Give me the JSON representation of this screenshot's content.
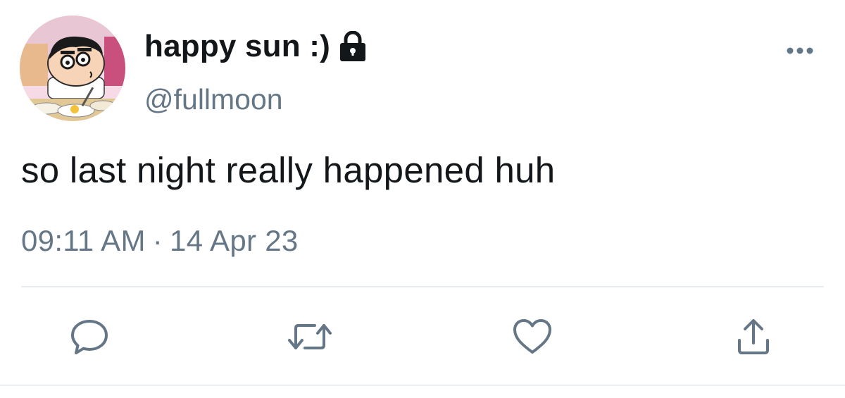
{
  "tweet": {
    "display_name": "happy sun :)",
    "handle": "@fullmoon",
    "protected": true,
    "text": "so last night really happened huh",
    "time": "09:11 AM",
    "separator": "·",
    "date": "14 Apr 23"
  },
  "icons": {
    "protected": "lock-icon",
    "more": "more-options-icon",
    "reply": "reply-icon",
    "retweet": "retweet-icon",
    "like": "heart-icon",
    "share": "share-icon"
  },
  "colors": {
    "text_primary": "#14171a",
    "text_secondary": "#657786",
    "icon": "#657786",
    "divider": "#e6ecf0"
  }
}
